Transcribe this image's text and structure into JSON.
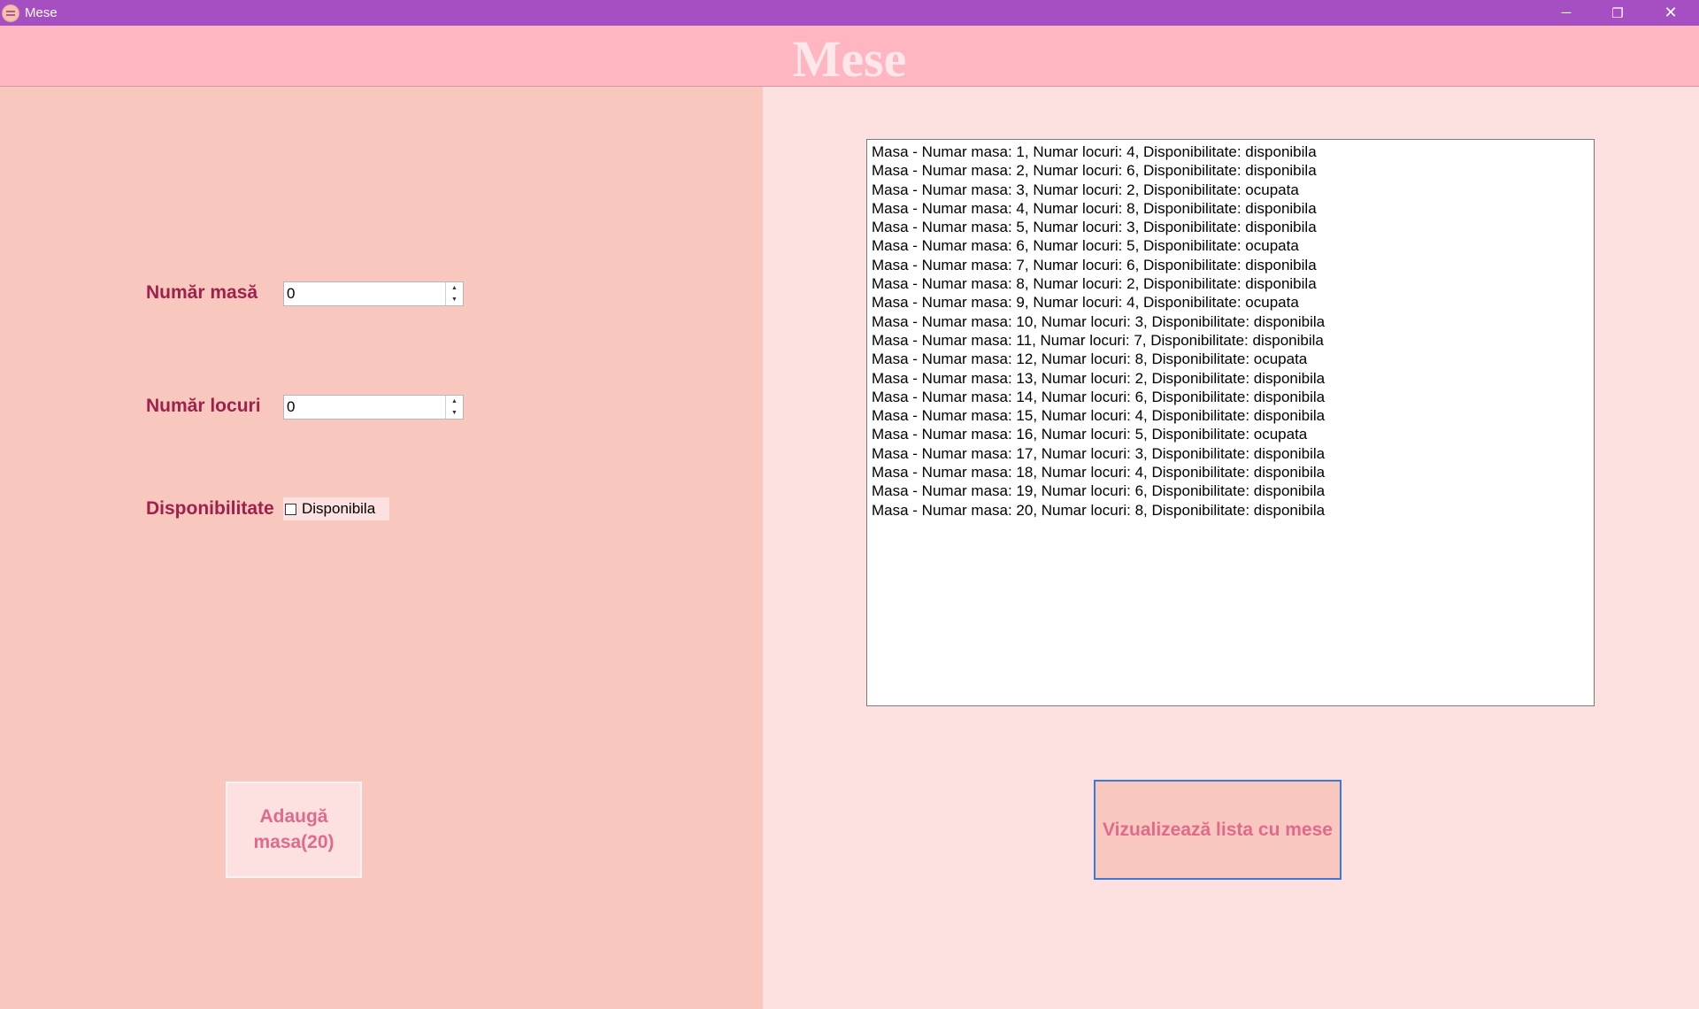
{
  "window": {
    "title": "Mese",
    "minimize_glyph": "─",
    "maximize_glyph": "❐",
    "close_glyph": "✕"
  },
  "header": {
    "title": "Mese"
  },
  "form": {
    "table_number": {
      "label": "Număr masă",
      "value": "0"
    },
    "seats": {
      "label": "Număr locuri",
      "value": "0"
    },
    "availability": {
      "label": "Disponibilitate",
      "checkbox_label": "Disponibila",
      "checked": false
    }
  },
  "spinner": {
    "up": "▲",
    "down": "▼"
  },
  "add_button": {
    "label": "Adaugă masa(20)"
  },
  "view_button": {
    "label": "Vizualizează lista cu mese"
  },
  "table_list": {
    "items": [
      "Masa - Numar masa: 1, Numar locuri: 4, Disponibilitate: disponibila",
      "Masa - Numar masa: 2, Numar locuri: 6, Disponibilitate: disponibila",
      "Masa - Numar masa: 3, Numar locuri: 2, Disponibilitate: ocupata",
      "Masa - Numar masa: 4, Numar locuri: 8, Disponibilitate: disponibila",
      "Masa - Numar masa: 5, Numar locuri: 3, Disponibilitate: disponibila",
      "Masa - Numar masa: 6, Numar locuri: 5, Disponibilitate: ocupata",
      "Masa - Numar masa: 7, Numar locuri: 6, Disponibilitate: disponibila",
      "Masa - Numar masa: 8, Numar locuri: 2, Disponibilitate: disponibila",
      "Masa - Numar masa: 9, Numar locuri: 4, Disponibilitate: ocupata",
      "Masa - Numar masa: 10, Numar locuri: 3, Disponibilitate: disponibila",
      "Masa - Numar masa: 11, Numar locuri: 7, Disponibilitate: disponibila",
      "Masa - Numar masa: 12, Numar locuri: 8, Disponibilitate: ocupata",
      "Masa - Numar masa: 13, Numar locuri: 2, Disponibilitate: disponibila",
      "Masa - Numar masa: 14, Numar locuri: 6, Disponibilitate: disponibila",
      "Masa - Numar masa: 15, Numar locuri: 4, Disponibilitate: disponibila",
      "Masa - Numar masa: 16, Numar locuri: 5, Disponibilitate: ocupata",
      "Masa - Numar masa: 17, Numar locuri: 3, Disponibilitate: disponibila",
      "Masa - Numar masa: 18, Numar locuri: 4, Disponibilitate: disponibila",
      "Masa - Numar masa: 19, Numar locuri: 6, Disponibilitate: disponibila",
      "Masa - Numar masa: 20, Numar locuri: 8, Disponibilitate: disponibila"
    ]
  },
  "colors": {
    "titlebar": "#a64fc3",
    "header_band": "#ffb6c1",
    "left_panel": "#f8c8bf",
    "right_panel": "#fde1e0",
    "label_text": "#a0204c",
    "button_text": "#e06a8c",
    "focus_border": "#3b78d8"
  }
}
